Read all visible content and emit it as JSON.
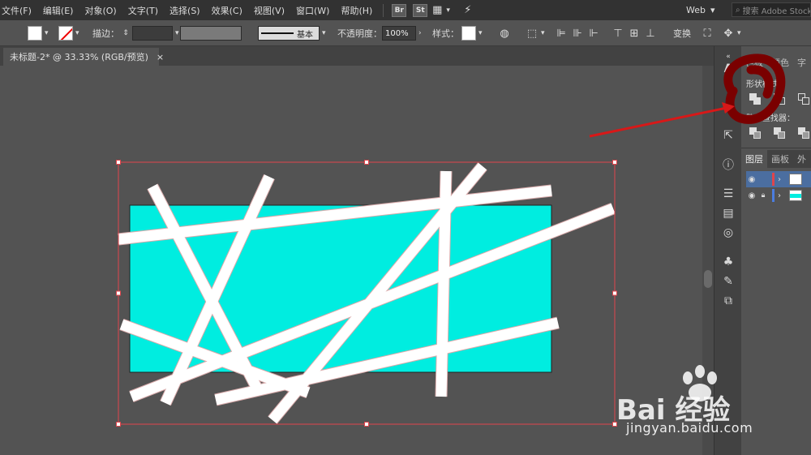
{
  "menubar": {
    "items": [
      "文件(F)",
      "编辑(E)",
      "对象(O)",
      "文字(T)",
      "选择(S)",
      "效果(C)",
      "视图(V)",
      "窗口(W)",
      "帮助(H)"
    ],
    "bridge": "Br",
    "stock": "St",
    "workspace": "Web",
    "search_placeholder": "搜索 Adobe Stock"
  },
  "controlbar": {
    "stroke_label": "描边：",
    "brush_label": "基本",
    "opacity_label": "不透明度：",
    "opacity_value": "100%",
    "style_label": "样式：",
    "transform_label": "变换"
  },
  "document": {
    "tab_title": "未标题-2* @ 33.33% (RGB/预览)",
    "close_glyph": "×"
  },
  "pathfinder_panel": {
    "tabs": [
      "色板",
      "颜色",
      "字"
    ],
    "shape_modes_label": "形状模式：",
    "pathfinders_label": "路径查找器："
  },
  "layers_panel": {
    "tabs": [
      "图层",
      "画板",
      "外"
    ],
    "rows": [
      {
        "color": "#e0454c",
        "locked": false,
        "selected": true
      },
      {
        "color": "#4b7de0",
        "locked": true,
        "selected": false
      }
    ]
  },
  "artwork": {
    "rect_fill": "#00ede0",
    "bar_fill": "#ffffff",
    "selection_color": "#e0454c"
  },
  "watermark": {
    "brand": "Bai 经验",
    "url": "jingyan.baidu.com"
  },
  "colors": {
    "annotation_red": "#d81818",
    "annotation_marker": "#7a0000"
  }
}
